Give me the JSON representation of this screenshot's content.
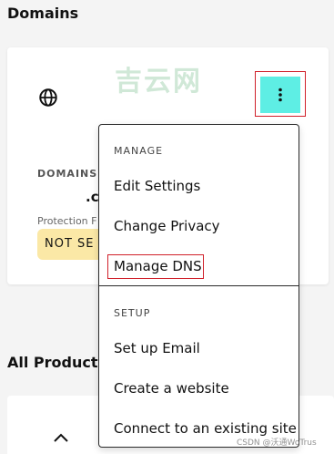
{
  "page": {
    "domains_title": "Domains",
    "all_products_title": "All Products"
  },
  "domain_card": {
    "globe_icon": "globe-icon",
    "watermark": "吉云网",
    "domains_label": "DOMAINS",
    "domain_name": ".c",
    "protection_label": "Protection F",
    "status_badge": "NOT SE",
    "menu_icon": "kebab-menu-icon"
  },
  "menu": {
    "manage_heading": "MANAGE",
    "items_manage": [
      "Edit Settings",
      "Change Privacy",
      "Manage DNS"
    ],
    "setup_heading": "SETUP",
    "items_setup": [
      "Set up Email",
      "Create a website",
      "Connect to an existing site"
    ]
  },
  "products": {
    "chevron_icon": "chevron-up-icon"
  },
  "credit": "CSDN @沃通WoTrus",
  "colors": {
    "kebab_button_bg": "#5eeee4",
    "highlight_border": "#d0202a",
    "badge_bg": "#fbe8a6"
  }
}
